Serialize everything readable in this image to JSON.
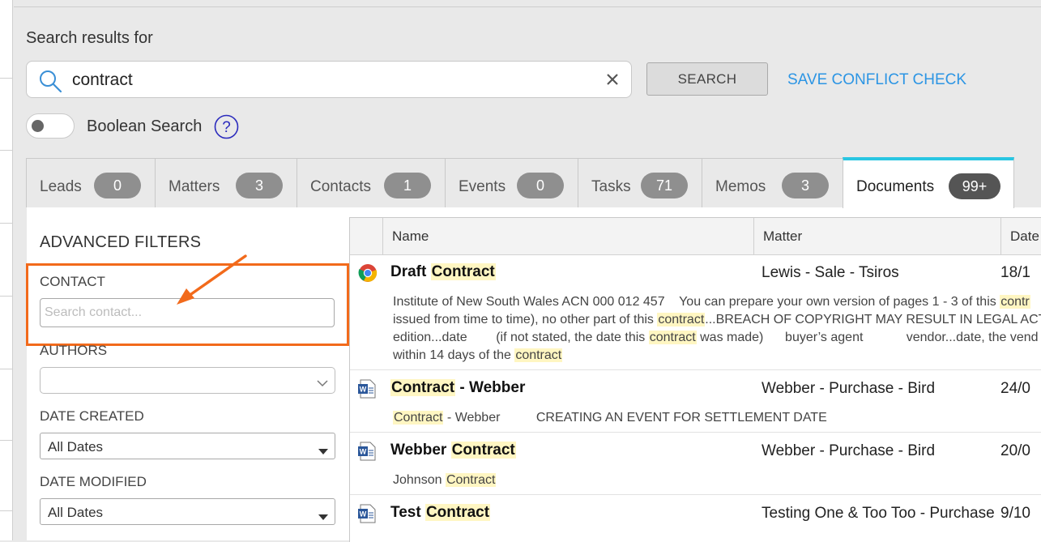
{
  "search": {
    "label": "Search results for",
    "query": "contract",
    "search_button": "SEARCH",
    "save_link": "SAVE CONFLICT CHECK",
    "boolean_label": "Boolean Search",
    "help_glyph": "?"
  },
  "tabs": [
    {
      "label": "Leads",
      "count": "0"
    },
    {
      "label": "Matters",
      "count": "3"
    },
    {
      "label": "Contacts",
      "count": "1"
    },
    {
      "label": "Events",
      "count": "0"
    },
    {
      "label": "Tasks",
      "count": "71"
    },
    {
      "label": "Memos",
      "count": "3"
    },
    {
      "label": "Documents",
      "count": "99+",
      "active": true
    }
  ],
  "filters": {
    "title": "ADVANCED FILTERS",
    "contact_label": "CONTACT",
    "contact_placeholder": "Search contact...",
    "authors_label": "AUTHORS",
    "date_created_label": "DATE CREATED",
    "date_created_value": "All Dates",
    "date_modified_label": "DATE MODIFIED",
    "date_modified_value": "All Dates"
  },
  "grid": {
    "columns": [
      "Name",
      "Matter",
      "Date"
    ],
    "rows": [
      {
        "icon": "chrome-icon",
        "title_parts": [
          "Draft ",
          "Contract"
        ],
        "matter": "Lewis - Sale - Tsiros",
        "date": "18/1",
        "snippet_lines": [
          [
            "Institute of New South Wales ACN 000 012 457    You can prepare your own version of pages 1 - 3 of this ",
            "contr"
          ],
          [
            "issued from time to time), no other part of this ",
            "contract",
            "...BREACH OF COPYRIGHT MAY RESULT IN LEGAL ACTIO"
          ],
          [
            "edition...date        (if not stated, the date this ",
            "contract",
            " was made)      buyer’s agent            vendor...date, the vend"
          ],
          [
            "within 14 days of the ",
            "contract"
          ]
        ]
      },
      {
        "icon": "word-doc-icon",
        "title_parts": [
          "Contract",
          " - Webber"
        ],
        "matter": "Webber - Purchase - Bird",
        "date": "24/0",
        "snippet_lines": [
          [
            "",
            "Contract",
            " - Webber          CREATING AN EVENT FOR SETTLEMENT DATE"
          ]
        ]
      },
      {
        "icon": "word-doc-icon",
        "title_parts": [
          "Webber ",
          "Contract"
        ],
        "matter": "Webber - Purchase - Bird",
        "date": "20/0",
        "snippet_lines": [
          [
            "Johnson ",
            "Contract"
          ]
        ]
      },
      {
        "icon": "word-doc-icon",
        "title_parts": [
          "Test ",
          "Contract"
        ],
        "matter": "Testing One & Too Too - Purchase",
        "date": "9/10"
      }
    ]
  },
  "colors": {
    "accent_tab": "#29c6e2",
    "link": "#2c95e4",
    "highlight_frame": "#f26a1b",
    "match_highlight": "#fff6c2"
  }
}
